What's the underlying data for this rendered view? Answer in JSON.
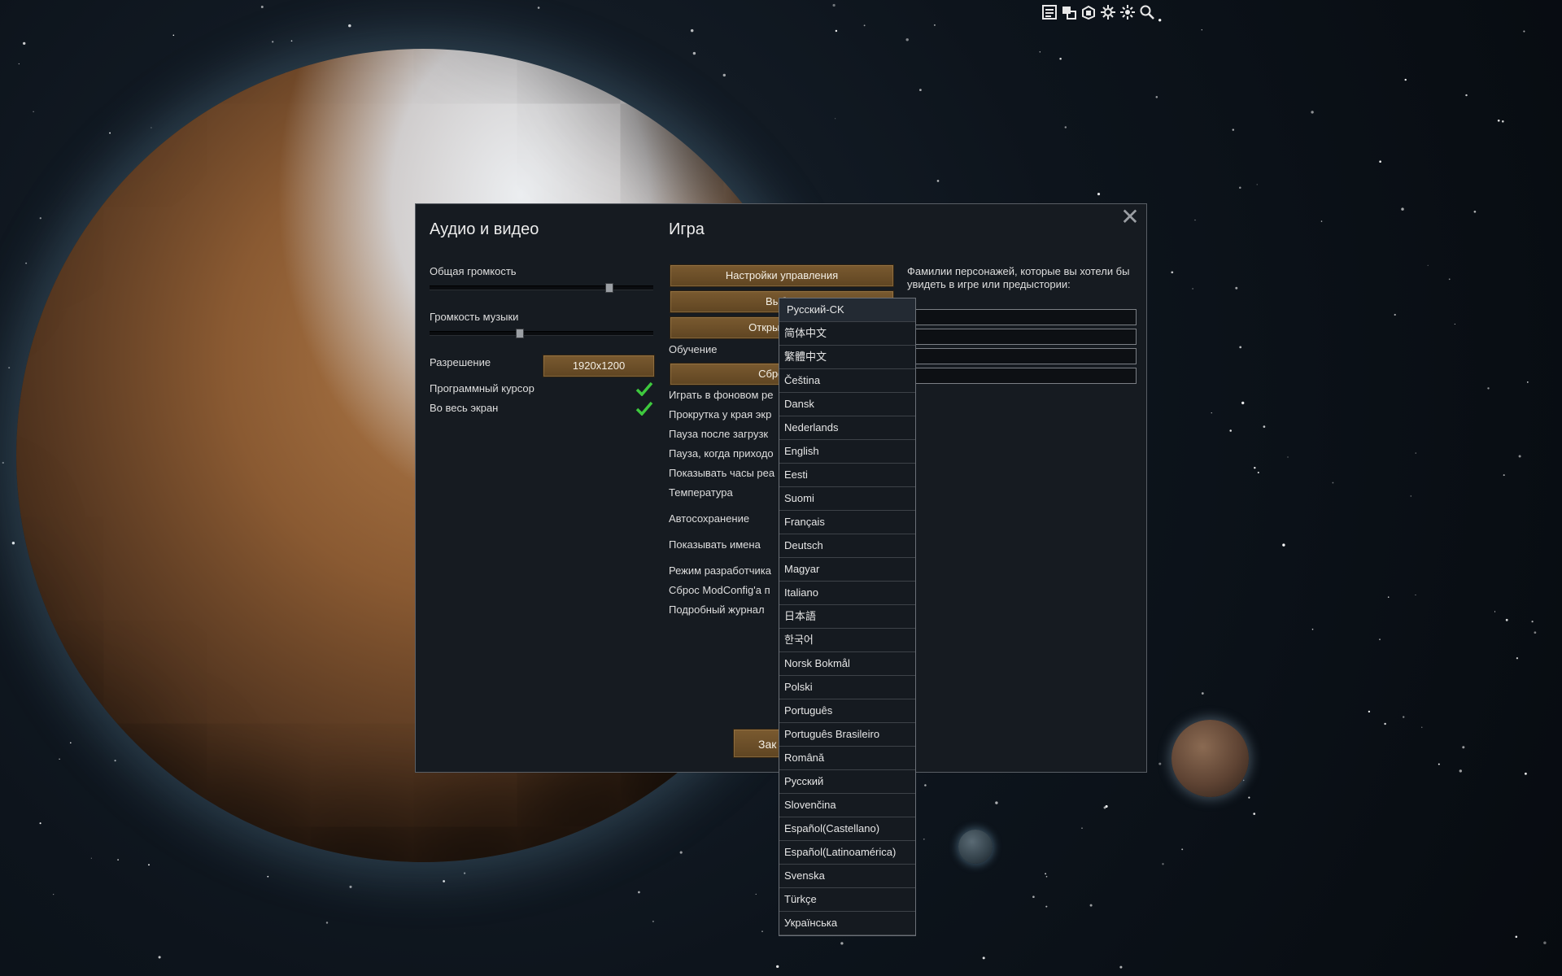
{
  "toolbar": {
    "icons": [
      "log-icon",
      "windows-icon",
      "dev-icon",
      "settings-gear-icon",
      "settings-gear-alt-icon",
      "search-icon"
    ]
  },
  "dialog": {
    "audio_video": {
      "title": "Аудио и видео",
      "master_volume_label": "Общая громкость",
      "master_volume": 0.8,
      "music_volume_label": "Громкость музыки",
      "music_volume": 0.4,
      "resolution_label": "Разрешение",
      "resolution_value": "1920x1200",
      "software_cursor_label": "Программный курсор",
      "software_cursor": true,
      "fullscreen_label": "Во весь экран",
      "fullscreen": true
    },
    "game": {
      "title": "Игра",
      "controls_button": "Настройки управления",
      "language_button": "Выбор",
      "open_folder_button": "Открыть папк",
      "tutorial_label": "Обучение",
      "reset_button": "Сбросить",
      "options": [
        "Играть в фоновом ре",
        "Прокрутка у края экр",
        "Пауза после загрузк",
        "Пауза, когда приходо",
        "Показывать часы реа",
        "Температура",
        "Автосохранение",
        "Показывать имена",
        "Режим разработчика",
        "Сброс ModConfig'a п",
        "Подробный журнал"
      ],
      "close_button": "Зак"
    },
    "names": {
      "description": "Фамилии персонажей, которые вы хотели бы увидеть в игре или предыстории:"
    }
  },
  "language_dropdown": {
    "selected": "Русский-CK",
    "items": [
      "Русский-CK",
      "简体中文",
      "繁體中文",
      "Čeština",
      "Dansk",
      "Nederlands",
      "English",
      "Eesti",
      "Suomi",
      "Français",
      "Deutsch",
      "Magyar",
      "Italiano",
      "日本語",
      "한국어",
      "Norsk Bokmål",
      "Polski",
      "Português",
      "Português Brasileiro",
      "Română",
      "Русский",
      "Slovenčina",
      "Español(Castellano)",
      "Español(Latinoamérica)",
      "Svenska",
      "Türkçe",
      "Українська"
    ]
  },
  "colors": {
    "accent_wood": "#6b4e28",
    "check_green": "#3ec83e",
    "panel_bg": "#161b21"
  }
}
